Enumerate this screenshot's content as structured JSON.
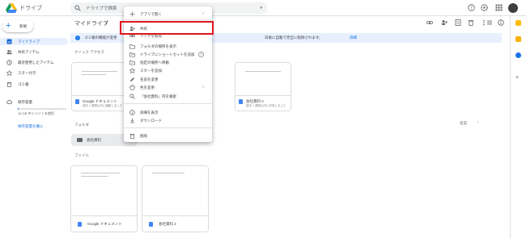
{
  "header": {
    "app_name": "ドライブ",
    "search_placeholder": "ドライブで検索",
    "icons": [
      "help-icon",
      "settings-icon",
      "apps-icon",
      "avatar"
    ]
  },
  "sidebar": {
    "new_label": "新規",
    "items": [
      {
        "label": "マイドライブ",
        "icon": "drive-icon",
        "active": true
      },
      {
        "label": "共有アイテム",
        "icon": "people-icon"
      },
      {
        "label": "最近使用したアイテム",
        "icon": "clock-icon"
      },
      {
        "label": "スター付き",
        "icon": "star-icon"
      },
      {
        "label": "ゴミ箱",
        "icon": "trash-icon"
      },
      {
        "label": "保存容量",
        "icon": "cloud-icon"
      }
    ],
    "storage_text": "15 GB 中 0 バイトを使用",
    "storage_fraction": 0.02,
    "buy_label": "保存容量を購入"
  },
  "main": {
    "title": "マイドライブ",
    "banner_text": "ゴミ箱の機能が変更",
    "banner_text2": "日後に自動で完全に削除されます。",
    "banner_link": "詳細",
    "quick_access_title": "クイック アクセス",
    "quick_cards": [
      {
        "name": "Google ドキュメント",
        "sub": "過去 1 週間以内に編集しました"
      },
      {
        "name": "会社資料 2",
        "sub": "過去 1 週間以内に作成しました"
      }
    ],
    "folders_title": "フォルダ",
    "sort_label": "名前",
    "folder_name": "会社資料",
    "files_title": "ファイル",
    "files": [
      {
        "name": "Google ドキュメント"
      },
      {
        "name": "会社資料 2"
      }
    ]
  },
  "context_menu": {
    "items": [
      {
        "label": "アプリで開く",
        "icon": "open-with-icon",
        "has_submenu": true
      },
      {
        "label": "共有",
        "icon": "share-icon",
        "highlighted": true
      },
      {
        "label": "リンクを取得",
        "icon": "link-icon"
      },
      {
        "label": "フォルダの場所を表示",
        "icon": "folder-icon"
      },
      {
        "label": "ドライブにショートカットを追加",
        "icon": "shortcut-icon"
      },
      {
        "label": "指定の場所へ移動",
        "icon": "move-icon"
      },
      {
        "label": "スターを追加",
        "icon": "star-icon"
      },
      {
        "label": "名前を変更",
        "icon": "edit-icon"
      },
      {
        "label": "色を変更",
        "icon": "palette-icon",
        "has_submenu": true
      },
      {
        "label": "「会社資料」内を検索",
        "icon": "search-icon"
      },
      {
        "label": "詳細を表示",
        "icon": "info-icon"
      },
      {
        "label": "ダウンロード",
        "icon": "download-icon"
      },
      {
        "label": "削除",
        "icon": "trash-icon"
      }
    ],
    "highlight_color": "#e0151d"
  },
  "colors": {
    "accent": "#1a73e8",
    "active_bg": "#e8f0fe",
    "doc_blue": "#4285f4"
  }
}
